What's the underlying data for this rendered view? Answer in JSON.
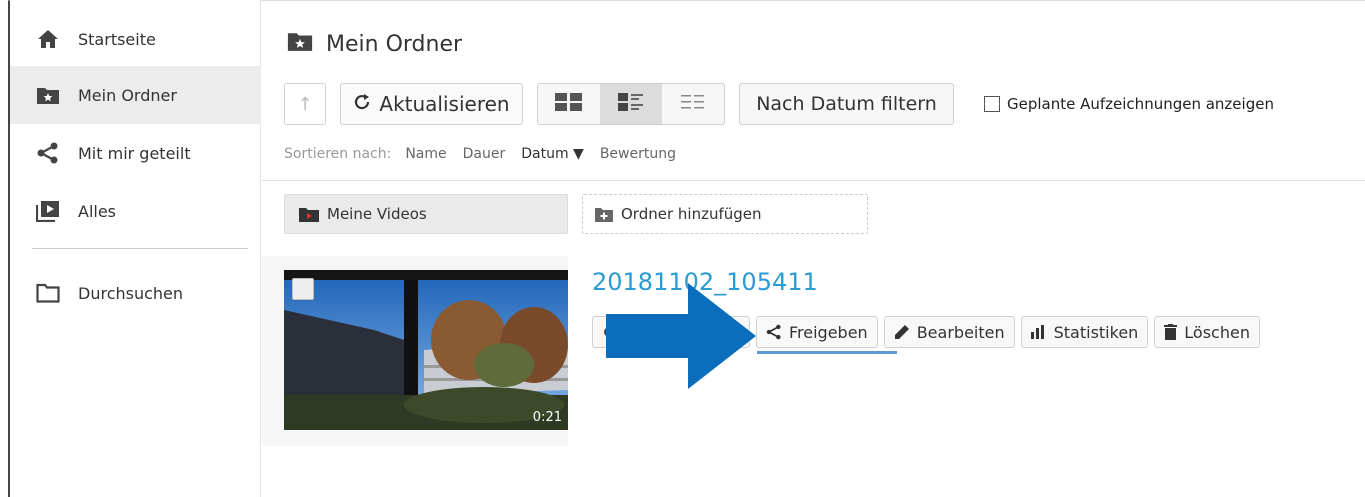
{
  "sidebar": {
    "items": [
      {
        "label": "Startseite",
        "icon": "home-icon"
      },
      {
        "label": "Mein Ordner",
        "icon": "folder-star-icon",
        "active": true
      },
      {
        "label": "Mit mir geteilt",
        "icon": "share-icon"
      },
      {
        "label": "Alles",
        "icon": "play-library-icon"
      },
      {
        "label": "Durchsuchen",
        "icon": "folder-outline-icon"
      }
    ]
  },
  "main": {
    "title": "Mein Ordner",
    "toolbar": {
      "refresh_label": "Aktualisieren",
      "date_filter_label": "Nach Datum filtern",
      "scheduled_checkbox_label": "Geplante Aufzeichnungen anzeigen"
    },
    "sort": {
      "label": "Sortieren nach:",
      "options": [
        "Name",
        "Dauer",
        "Datum ▼",
        "Bewertung"
      ],
      "selected": "Datum ▼"
    },
    "folders": {
      "my_videos_label": "Meine Videos",
      "add_folder_label": "Ordner hinzufügen"
    },
    "video": {
      "title": "20181102_105411",
      "duration": "0:21",
      "actions": {
        "share_label": "Freigeben",
        "edit_label": "Bearbeiten",
        "stats_label": "Statistiken",
        "delete_label": "Löschen"
      }
    }
  },
  "colors": {
    "accent": "#2a9bd3",
    "arrow": "#0a6ebd",
    "underline": "#5b9bd5",
    "active_bg": "#ececec"
  }
}
